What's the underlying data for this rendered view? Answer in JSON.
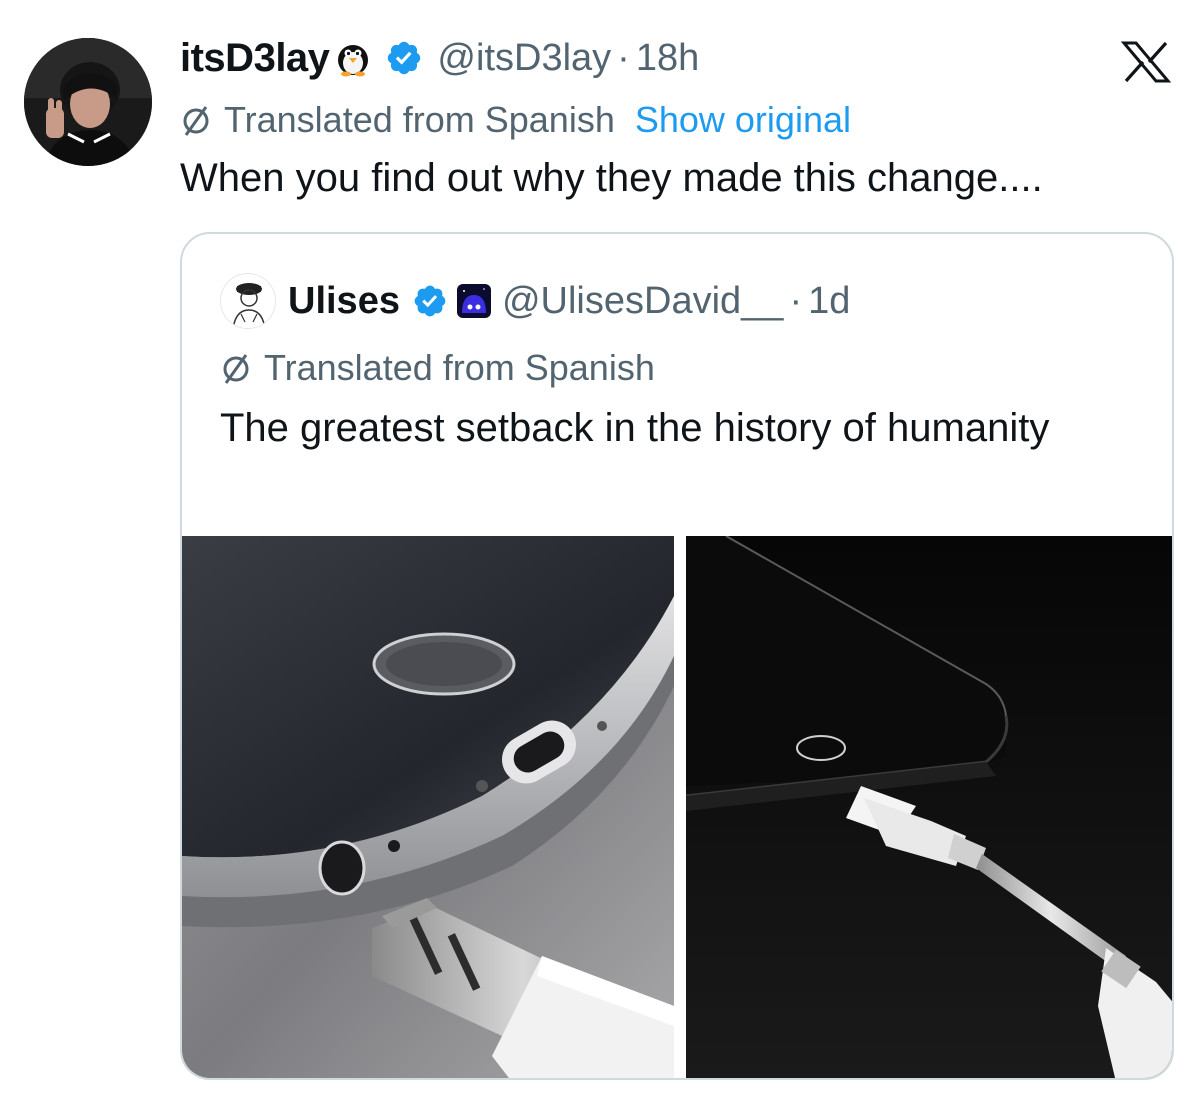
{
  "tweet": {
    "display_name": "itsD3lay",
    "handle": "@itsD3lay",
    "separator": "·",
    "time": "18h",
    "translated_label": "Translated from Spanish",
    "show_original": "Show original",
    "text": "When you find out why they made this change....",
    "icons": {
      "emoji": "penguin-emoji-icon",
      "verified": "verified-badge-icon",
      "translate": "translate-icon",
      "close": "x-logo-icon"
    }
  },
  "quote": {
    "display_name": "Ulises",
    "handle": "@UlisesDavid__",
    "separator": "·",
    "time": "1d",
    "translated_label": "Translated from Spanish",
    "text": "The greatest setback in the history of humanity",
    "icons": {
      "verified": "verified-badge-icon",
      "affiliate": "affiliate-badge-icon"
    }
  },
  "colors": {
    "text": "#0f1419",
    "secondary": "#536471",
    "link": "#1d9bf0",
    "verified": "#1d9bf0",
    "border": "#cfd9de"
  }
}
